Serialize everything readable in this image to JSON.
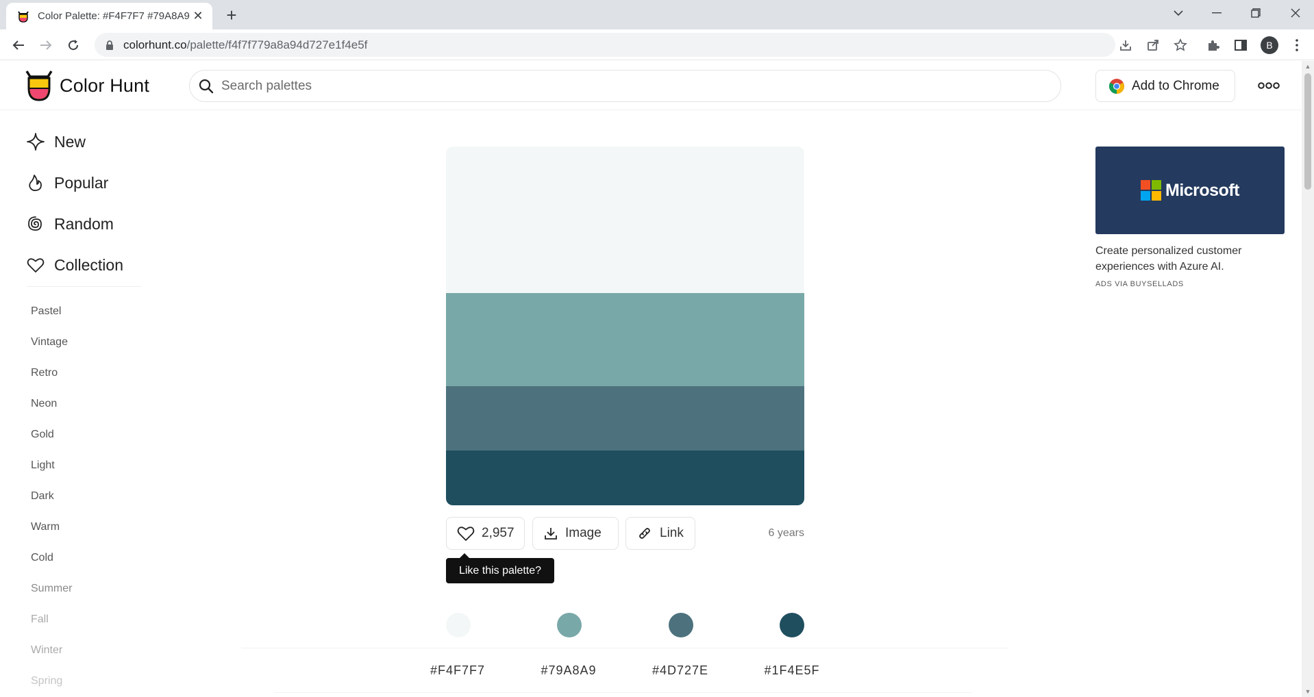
{
  "browser": {
    "tab_title": "Color Palette: #F4F7F7 #79A8A9",
    "url_host": "colorhunt.co",
    "url_path": "/palette/f4f7f779a8a94d727e1f4e5f",
    "profile_initial": "B"
  },
  "header": {
    "logo_text": "Color Hunt",
    "search_placeholder": "Search palettes",
    "add_to_chrome_label": "Add to Chrome"
  },
  "sidebar": {
    "nav": [
      {
        "label": "New",
        "icon": "sparkle-icon"
      },
      {
        "label": "Popular",
        "icon": "flame-icon"
      },
      {
        "label": "Random",
        "icon": "spiral-icon"
      },
      {
        "label": "Collection",
        "icon": "heart-icon"
      }
    ],
    "tags": [
      "Pastel",
      "Vintage",
      "Retro",
      "Neon",
      "Gold",
      "Light",
      "Dark",
      "Warm",
      "Cold",
      "Summer",
      "Fall",
      "Winter",
      "Spring"
    ]
  },
  "palette": {
    "colors": [
      "#F4F7F7",
      "#79A8A9",
      "#4D727E",
      "#1F4E5F"
    ],
    "likes": "2,957",
    "image_label": "Image",
    "link_label": "Link",
    "age": "6 years",
    "tooltip": "Like this palette?"
  },
  "ad": {
    "brand": "Microsoft",
    "text": "Create personalized customer experiences with Azure AI.",
    "via": "ADS VIA BUYSELLADS"
  }
}
